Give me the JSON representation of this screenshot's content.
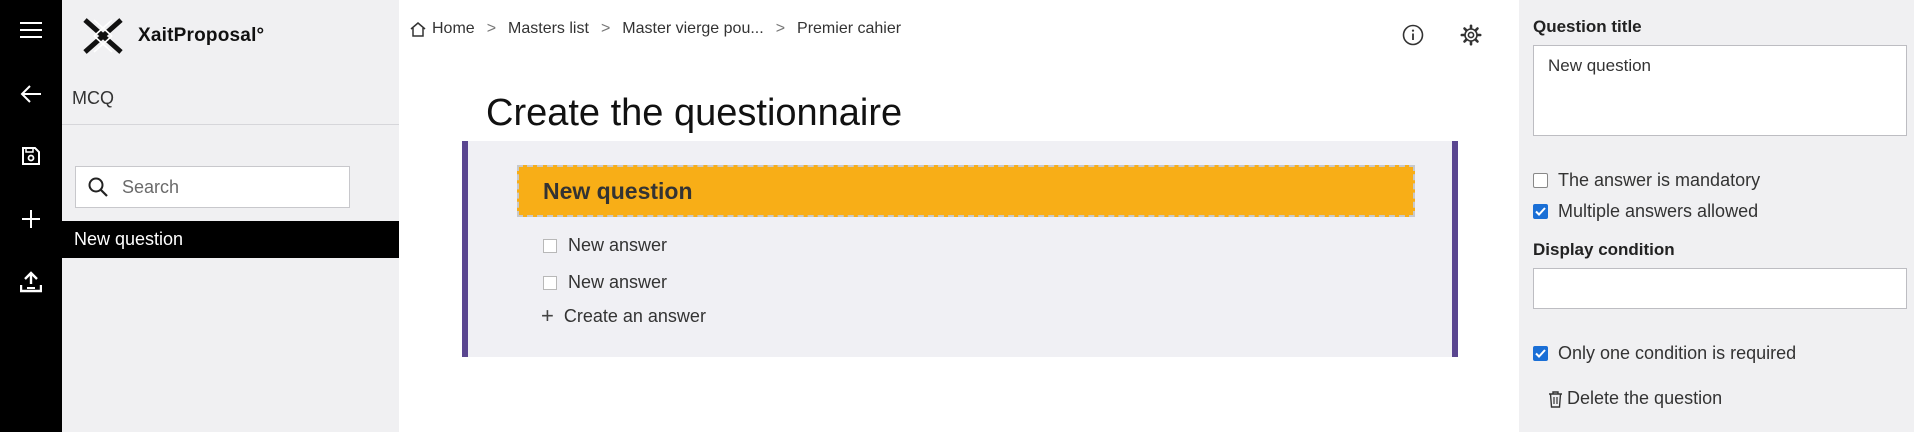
{
  "rail": {
    "icons": [
      "menu-icon",
      "back-arrow-icon",
      "save-icon",
      "plus-icon",
      "upload-icon"
    ]
  },
  "brand": {
    "name": "XaitProposal°"
  },
  "nav": {
    "section_title": "MCQ",
    "search_placeholder": "Search",
    "items": [
      {
        "label": "New question",
        "selected": true
      }
    ]
  },
  "breadcrumb": [
    "Home",
    "Masters list",
    "Master vierge pou...",
    "Premier cahier"
  ],
  "breadcrumb_separator": ">",
  "page_title": "Create the questionnaire",
  "question": {
    "title": "New question",
    "answers": [
      "New answer",
      "New answer"
    ],
    "create_answer_label": "Create an answer"
  },
  "panel": {
    "title_label": "Question title",
    "title_value": "New question",
    "mandatory_label": "The answer is mandatory",
    "mandatory_checked": false,
    "multiple_label": "Multiple answers allowed",
    "multiple_checked": true,
    "display_condition_label": "Display condition",
    "display_condition_value": "",
    "one_condition_label": "Only one condition is required",
    "one_condition_checked": true,
    "delete_label": "Delete the question"
  },
  "colors": {
    "rail": "#000000",
    "accent_purple": "#5a4690",
    "question_header": "#f8ae17",
    "checkbox_checked": "#1a6fd6"
  }
}
